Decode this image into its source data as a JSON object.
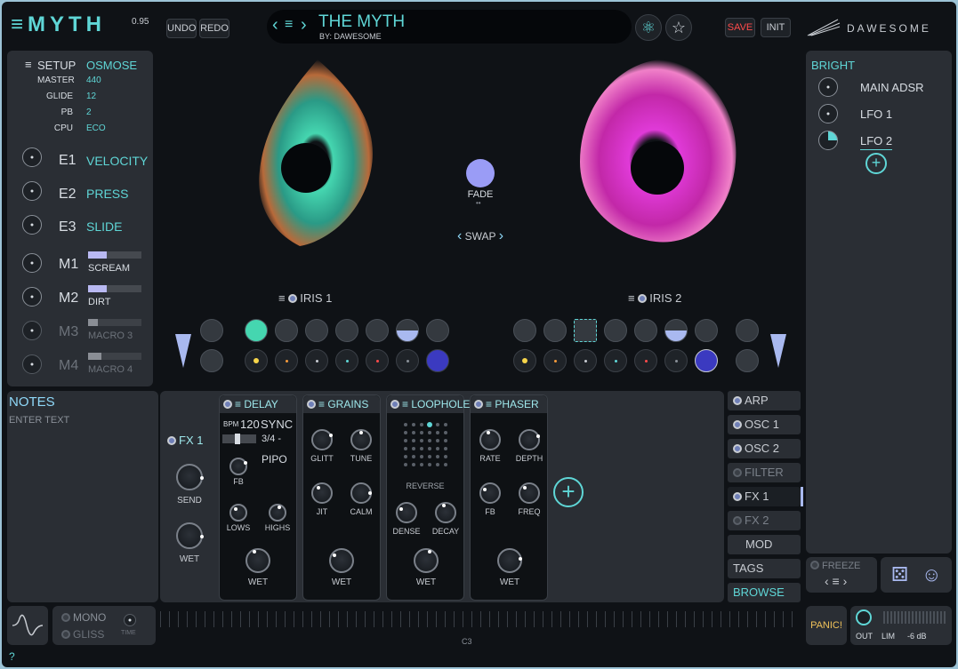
{
  "header": {
    "logo": "≡MYTH",
    "version": "0.95",
    "undo_label": "UNDO",
    "redo_label": "REDO",
    "preset_name": "THE MYTH",
    "preset_author": "BY: DAWESOME",
    "save_label": "SAVE",
    "init_label": "INIT",
    "brand": "DAWESOME"
  },
  "setup": {
    "title": "SETUP",
    "preset_mode": "OSMOSE",
    "rows": [
      {
        "label": "MASTER",
        "value": "440"
      },
      {
        "label": "GLIDE",
        "value": "12"
      },
      {
        "label": "PB",
        "value": "2"
      },
      {
        "label": "CPU",
        "value": "ECO"
      }
    ],
    "expressions": [
      {
        "key": "E1",
        "name": "VELOCITY"
      },
      {
        "key": "E2",
        "name": "PRESS"
      },
      {
        "key": "E3",
        "name": "SLIDE"
      }
    ],
    "macros": [
      {
        "key": "M1",
        "name": "SCREAM",
        "level": 0.35
      },
      {
        "key": "M2",
        "name": "DIRT",
        "level": 0.35
      },
      {
        "key": "M3",
        "name": "MACRO 3",
        "level": 0.18
      },
      {
        "key": "M4",
        "name": "MACRO 4",
        "level": 0.25
      }
    ]
  },
  "notes": {
    "title": "NOTES",
    "placeholder": "ENTER TEXT"
  },
  "center": {
    "fade_label": "FADE",
    "swap_label": "SWAP",
    "iris1_label": "IRIS 1",
    "iris2_label": "IRIS 2"
  },
  "modulators": {
    "title": "BRIGHT",
    "items": [
      {
        "label": "MAIN ADSR"
      },
      {
        "label": "LFO 1"
      },
      {
        "label": "LFO 2"
      }
    ]
  },
  "fx": {
    "fx1_label": "FX 1",
    "send_label": "SEND",
    "wet_label": "WET",
    "delay": {
      "title": "DELAY",
      "bpm_label": "BPM",
      "bpm": "120",
      "sync": "SYNC",
      "division": "3/4 -",
      "mode": "PIPO",
      "fb": "FB",
      "lows": "LOWS",
      "highs": "HIGHS",
      "wet": "WET"
    },
    "grains": {
      "title": "GRAINS",
      "glitt": "GLITT",
      "tune": "TUNE",
      "jit": "JIT",
      "calm": "CALM",
      "wet": "WET"
    },
    "loophole": {
      "title": "LOOPHOLE",
      "reverse": "REVERSE",
      "dense": "DENSE",
      "decay": "DECAY",
      "wet": "WET"
    },
    "phaser": {
      "title": "PHASER",
      "rate": "RATE",
      "depth": "DEPTH",
      "fb": "FB",
      "freq": "FREQ",
      "wet": "WET"
    }
  },
  "nav": {
    "arp": "ARP",
    "osc1": "OSC 1",
    "osc2": "OSC 2",
    "filter": "FILTER",
    "fx1": "FX 1",
    "fx2": "FX 2",
    "mod": "MOD",
    "tags": "TAGS",
    "browse": "BROWSE"
  },
  "footer": {
    "freeze_label": "FREEZE",
    "mono_label": "MONO",
    "gliss_label": "GLISS",
    "time_label": "TIME",
    "keyboard_note": "C3",
    "panic_label": "PANIC!",
    "out_label": "OUT",
    "lim_label": "LIM",
    "lim_value": "-6 dB",
    "help": "?"
  },
  "colors": {
    "accent": "#5fd6d6",
    "save": "#ff4b4b",
    "iris1": "#45d6b0",
    "iris2": "#e03ad8",
    "fade_knob": "#9a9cf6"
  }
}
